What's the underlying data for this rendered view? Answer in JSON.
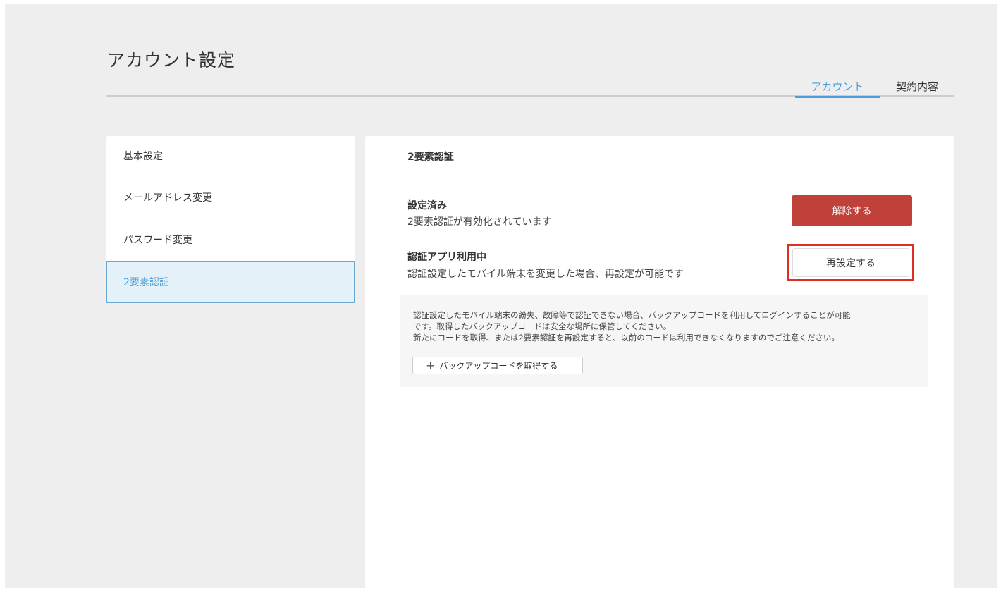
{
  "page": {
    "title": "アカウント設定"
  },
  "tabs": [
    {
      "label": "アカウント",
      "active": true
    },
    {
      "label": "契約内容",
      "active": false
    }
  ],
  "sidebar": {
    "items": [
      {
        "label": "基本設定",
        "active": false
      },
      {
        "label": "メールアドレス変更",
        "active": false
      },
      {
        "label": "パスワード変更",
        "active": false
      },
      {
        "label": "2要素認証",
        "active": true
      }
    ]
  },
  "content": {
    "title": "2要素認証",
    "status": {
      "title": "設定済み",
      "description": "2要素認証が有効化されています",
      "button_label": "解除する"
    },
    "auth_app": {
      "title": "認証アプリ利用中",
      "description": "認証設定したモバイル端末を変更した場合、再設定が可能です",
      "button_label": "再設定する"
    },
    "backup": {
      "lines": [
        "認証設定したモバイル端末の紛失、故障等で認証できない場合、バックアップコードを利用してログインすることが可能",
        "です。取得したバックアップコードは安全な場所に保管してください。",
        "新たにコードを取得、または2要素認証を再設定すると、以前のコードは利用できなくなりますのでご注意ください。"
      ],
      "button_icon": "plus-icon",
      "button_label": "バックアップコードを取得する"
    }
  },
  "colors": {
    "accent": "#4a9fd8",
    "danger": "#c0403a",
    "highlight": "#e02e22",
    "background": "#eeeeee"
  }
}
